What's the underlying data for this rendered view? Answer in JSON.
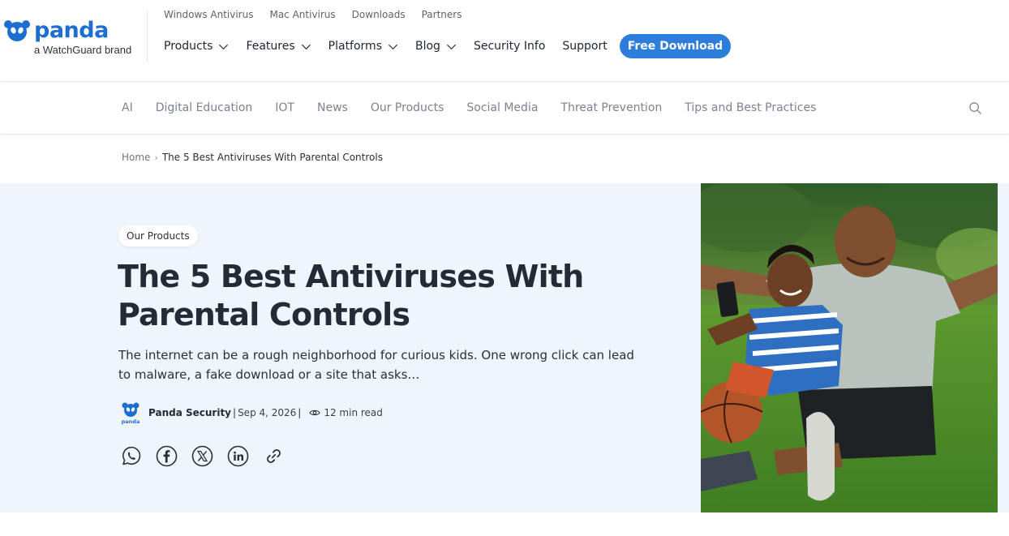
{
  "brand": {
    "name": "panda",
    "tagline": "a WatchGuard brand",
    "accent_color": "#1c6fd0"
  },
  "utility_nav": [
    "Windows Antivirus",
    "Mac Antivirus",
    "Downloads",
    "Partners"
  ],
  "main_nav": {
    "products": "Products",
    "features": "Features",
    "platforms": "Platforms",
    "blog": "Blog",
    "security_info": "Security Info",
    "support": "Support",
    "cta": "Free Download"
  },
  "categories": [
    "AI",
    "Digital Education",
    "IOT",
    "News",
    "Our Products",
    "Social Media",
    "Threat Prevention",
    "Tips and Best Practices"
  ],
  "breadcrumb": {
    "home": "Home",
    "separator": "›",
    "current": "The 5 Best Antiviruses With Parental Controls"
  },
  "article": {
    "category": "Our Products",
    "title": "The 5 Best Antiviruses With Parental Controls",
    "excerpt": "The internet can be a rough neighborhood for curious kids. One wrong click can lead to malware, a fake download or a site that asks…",
    "author": "Panda Security",
    "date": "Sep 4, 2026",
    "read_time": "12 min read",
    "avatar_label": "panda"
  },
  "share_icons": [
    "whatsapp-icon",
    "facebook-icon",
    "x-icon",
    "linkedin-icon",
    "link-icon"
  ],
  "colors": {
    "cta_background": "#2d7ddb",
    "hero_background": "#f0f5fc",
    "heading": "#242a36"
  }
}
